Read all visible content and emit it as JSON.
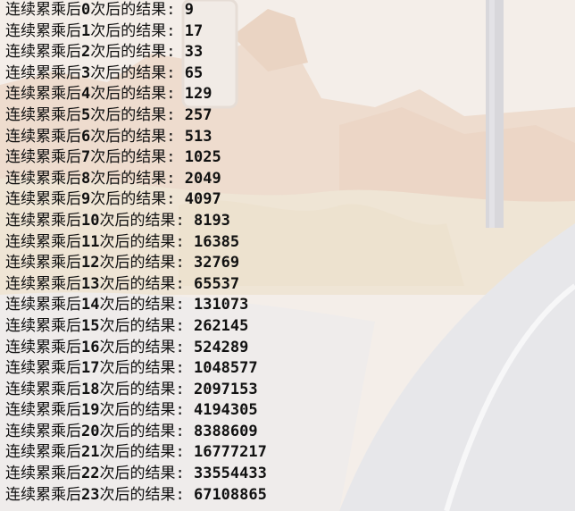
{
  "console": {
    "lines": [
      {
        "prefix": "连续累乘后",
        "n": "0",
        "suffix": "次后的结果",
        "sep": ": ",
        "value": "9"
      },
      {
        "prefix": "连续累乘后",
        "n": "1",
        "suffix": "次后的结果",
        "sep": ": ",
        "value": "17"
      },
      {
        "prefix": "连续累乘后",
        "n": "2",
        "suffix": "次后的结果",
        "sep": ": ",
        "value": "33"
      },
      {
        "prefix": "连续累乘后",
        "n": "3",
        "suffix": "次后的结果",
        "sep": ": ",
        "value": "65"
      },
      {
        "prefix": "连续累乘后",
        "n": "4",
        "suffix": "次后的结果",
        "sep": ": ",
        "value": "129"
      },
      {
        "prefix": "连续累乘后",
        "n": "5",
        "suffix": "次后的结果",
        "sep": ": ",
        "value": "257"
      },
      {
        "prefix": "连续累乘后",
        "n": "6",
        "suffix": "次后的结果",
        "sep": ": ",
        "value": "513"
      },
      {
        "prefix": "连续累乘后",
        "n": "7",
        "suffix": "次后的结果",
        "sep": ": ",
        "value": "1025"
      },
      {
        "prefix": "连续累乘后",
        "n": "8",
        "suffix": "次后的结果",
        "sep": ": ",
        "value": "2049"
      },
      {
        "prefix": "连续累乘后",
        "n": "9",
        "suffix": "次后的结果",
        "sep": ": ",
        "value": "4097"
      },
      {
        "prefix": "连续累乘后",
        "n": "10",
        "suffix": "次后的结果",
        "sep": ": ",
        "value": "8193"
      },
      {
        "prefix": "连续累乘后",
        "n": "11",
        "suffix": "次后的结果",
        "sep": ": ",
        "value": "16385"
      },
      {
        "prefix": "连续累乘后",
        "n": "12",
        "suffix": "次后的结果",
        "sep": ": ",
        "value": "32769"
      },
      {
        "prefix": "连续累乘后",
        "n": "13",
        "suffix": "次后的结果",
        "sep": ": ",
        "value": "65537"
      },
      {
        "prefix": "连续累乘后",
        "n": "14",
        "suffix": "次后的结果",
        "sep": ": ",
        "value": "131073"
      },
      {
        "prefix": "连续累乘后",
        "n": "15",
        "suffix": "次后的结果",
        "sep": ": ",
        "value": "262145"
      },
      {
        "prefix": "连续累乘后",
        "n": "16",
        "suffix": "次后的结果",
        "sep": ": ",
        "value": "524289"
      },
      {
        "prefix": "连续累乘后",
        "n": "17",
        "suffix": "次后的结果",
        "sep": ": ",
        "value": "1048577"
      },
      {
        "prefix": "连续累乘后",
        "n": "18",
        "suffix": "次后的结果",
        "sep": ": ",
        "value": "2097153"
      },
      {
        "prefix": "连续累乘后",
        "n": "19",
        "suffix": "次后的结果",
        "sep": ": ",
        "value": "4194305"
      },
      {
        "prefix": "连续累乘后",
        "n": "20",
        "suffix": "次后的结果",
        "sep": ": ",
        "value": "8388609"
      },
      {
        "prefix": "连续累乘后",
        "n": "21",
        "suffix": "次后的结果",
        "sep": ": ",
        "value": "16777217"
      },
      {
        "prefix": "连续累乘后",
        "n": "22",
        "suffix": "次后的结果",
        "sep": ": ",
        "value": "33554433"
      },
      {
        "prefix": "连续累乘后",
        "n": "23",
        "suffix": "次后的结果",
        "sep": ": ",
        "value": "67108865"
      }
    ]
  },
  "colors": {
    "text": "#111111",
    "background": "#f3efec",
    "wallpaper_sky": "#f4eee9",
    "wallpaper_mesa": "#ecd9c9",
    "wallpaper_brush": "#efe6d6",
    "wallpaper_road": "#e9e9ec",
    "wallpaper_post": "#d9d8dc"
  }
}
